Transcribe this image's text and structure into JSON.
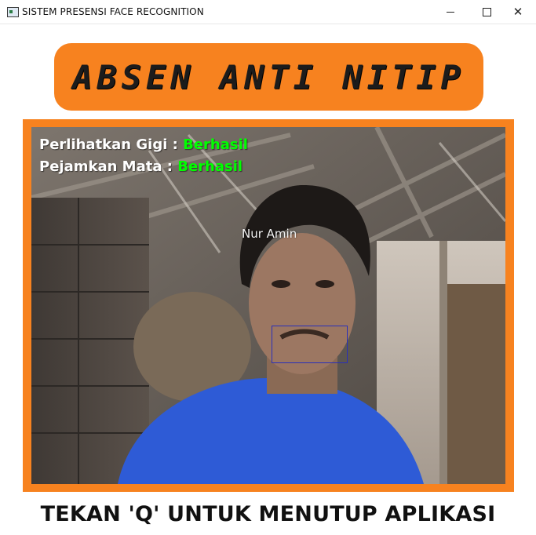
{
  "window": {
    "title": "SISTEM PRESENSI FACE RECOGNITION",
    "controls": {
      "minimize": "minimize-icon",
      "maximize": "maximize-icon",
      "close": "close-icon",
      "close_glyph": "✕"
    }
  },
  "banner": {
    "text": "ABSEN ANTI NITIP",
    "color": "#f7821f"
  },
  "camera": {
    "overlay": {
      "line1_label": "Perlihatkan Gigi : ",
      "line1_status": "Berhasil",
      "line2_label": "Pejamkan Mata : ",
      "line2_status": "Berhasil",
      "status_color": "#00ff00"
    },
    "face_name": "Nur Amin",
    "box_color": "#2a2fb8"
  },
  "footer": {
    "text": "TEKAN 'Q' UNTUK MENUTUP APLIKASI"
  }
}
